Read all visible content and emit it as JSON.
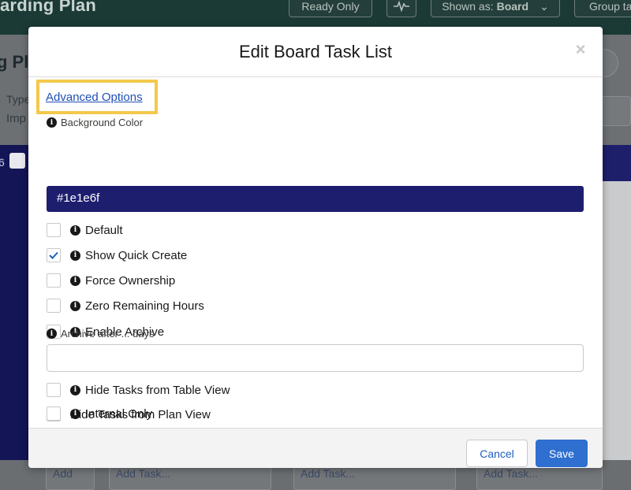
{
  "background": {
    "app_title": "arding Plan",
    "header_buttons": {
      "ready_only": "Ready Only",
      "shown_as_prefix": "Shown as:",
      "shown_as_value": "Board",
      "group": "Group ta"
    },
    "plan_title": "g Pla",
    "type_label": "Type",
    "type_value": "Imp",
    "column_count": "6",
    "add_label": "Add",
    "add_task_placeholder": "Add Task..."
  },
  "modal": {
    "title": "Edit Board Task List",
    "close_symbol": "×",
    "advanced_options_link": "Advanced Options",
    "background_color": {
      "label": "Background Color",
      "value": "#1e1e6f"
    },
    "checkboxes": [
      {
        "label": "Default",
        "checked": false,
        "info": true
      },
      {
        "label": "Show Quick Create",
        "checked": true,
        "info": true
      },
      {
        "label": "Force Ownership",
        "checked": false,
        "info": true
      },
      {
        "label": "Zero Remaining Hours",
        "checked": false,
        "info": true
      },
      {
        "label": "Enable Archive",
        "checked": false,
        "info": true
      }
    ],
    "archive_after": {
      "label": "Archive after ... days",
      "value": ""
    },
    "checkboxes_bottom": [
      {
        "label": "Hide Tasks from Table View",
        "checked": false,
        "info": true
      },
      {
        "label": "Hide Tasks from Plan View",
        "checked": false,
        "info": false
      },
      {
        "label": "Internal Only",
        "checked": false,
        "info": true
      }
    ],
    "footer": {
      "cancel_label": "Cancel",
      "save_label": "Save"
    }
  },
  "colors": {
    "accent_highlight": "#f3c94b",
    "save_button": "#2f6fd0",
    "link": "#1f4fb5",
    "color_field": "#1e1e6f"
  }
}
